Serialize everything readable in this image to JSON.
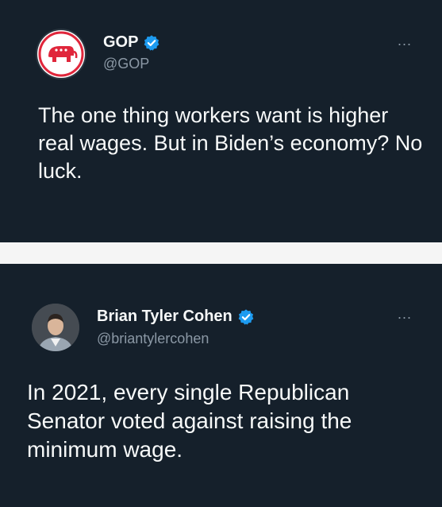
{
  "tweets": [
    {
      "name": "GOP",
      "handle": "@GOP",
      "verified": true,
      "avatar_icon": "gop-elephant-logo-icon",
      "more_label": "...",
      "text": "The one thing workers want is higher real wages. But in Biden’s economy? No luck."
    },
    {
      "name": "Brian Tyler Cohen",
      "handle": "@briantylercohen",
      "verified": true,
      "avatar_icon": "profile-photo",
      "more_label": "...",
      "text": "In 2021, every single Republican Senator voted against raising the minimum wage."
    }
  ],
  "colors": {
    "background": "#15202b",
    "text_primary": "#f7f9f9",
    "text_secondary": "#8b98a5",
    "verified_blue": "#1d9bf0",
    "gop_red": "#e0263b",
    "divider": "#f5f5f5"
  }
}
